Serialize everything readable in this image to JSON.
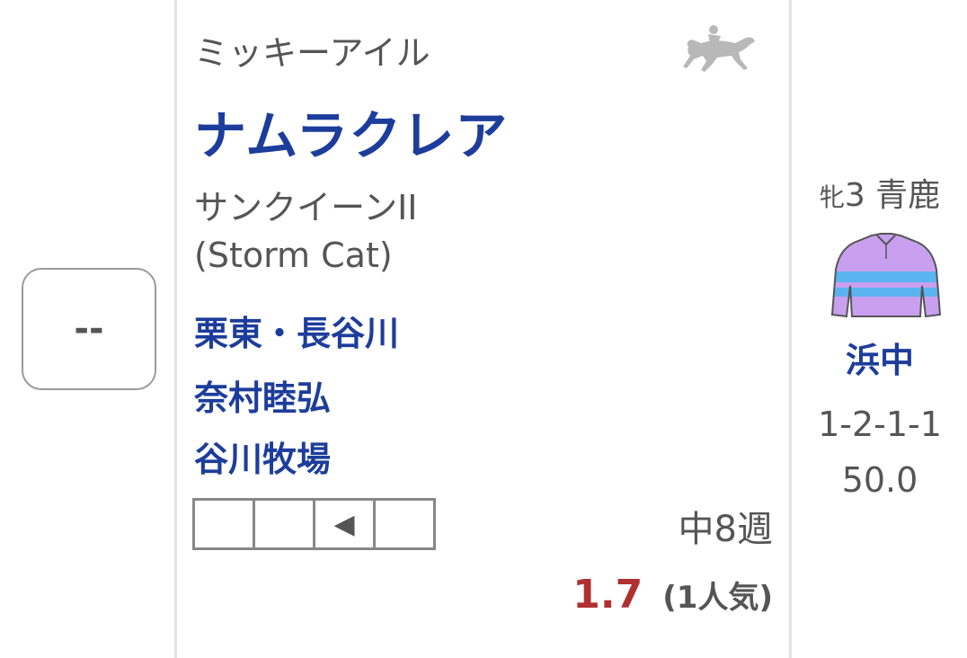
{
  "mark": "--",
  "horse": {
    "sire": "ミッキーアイル",
    "name": "ナムラクレア",
    "dam": "サンクイーンII",
    "damsire": "(Storm Cat)",
    "trainer": "栗東・長谷川",
    "owner": "奈村睦弘",
    "breeder": "谷川牧場"
  },
  "run_boxes": [
    "",
    "",
    "◀",
    ""
  ],
  "interval": "中8週",
  "odds": {
    "value": "1.7",
    "popularity": "(1人気)"
  },
  "info": {
    "sex_age_prefix": "牝",
    "sex_age_rest": "3 青鹿",
    "jockey": "浜中",
    "record": "1-2-1-1",
    "weight": "50.0"
  },
  "colors": {
    "link": "#1d3d9c",
    "odds": "#b03030",
    "silks_body": "#c9a0f0",
    "silks_stripe": "#5ab4f0",
    "icon_gray": "#b8b8b8"
  },
  "icons": {
    "horse": "racehorse-icon",
    "silks": "jockey-silks-icon"
  }
}
